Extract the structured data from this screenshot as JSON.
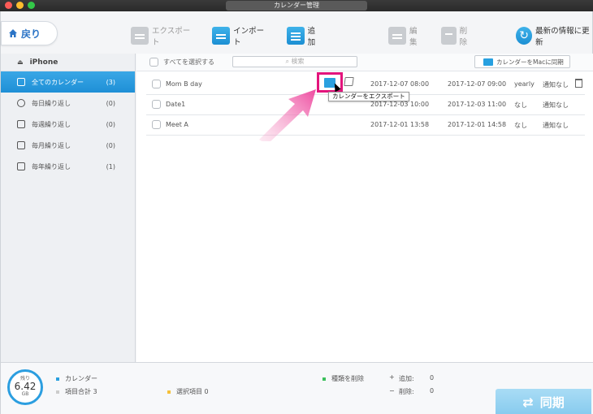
{
  "window": {
    "title": "カレンダー管理"
  },
  "nav": {
    "back_label": "戻り"
  },
  "toolbar": {
    "export_label": "エクスポート",
    "import_label": "インポート",
    "add_label": "追加",
    "edit_label": "編集",
    "delete_label": "削除",
    "refresh_label": "最新の情報に更新"
  },
  "sidebar": {
    "device": "iPhone",
    "items": [
      {
        "label": "全てのカレンダー",
        "count": "(3)"
      },
      {
        "label": "毎日繰り返し",
        "count": "(0)"
      },
      {
        "label": "毎週繰り返し",
        "count": "(0)"
      },
      {
        "label": "毎月繰り返し",
        "count": "(0)"
      },
      {
        "label": "毎年繰り返し",
        "count": "(1)"
      }
    ]
  },
  "list": {
    "select_all_label": "すべてを選択する",
    "search_placeholder": "検索",
    "sync_mac_label": "カレンダーをMacに同期",
    "rows": [
      {
        "name": "Mom  B day",
        "start": "2017-12-07 08:00",
        "end": "2017-12-07 09:00",
        "repeat": "yearly",
        "alert": "通知なし"
      },
      {
        "name": "Date1",
        "start": "2017-12-03 10:00",
        "end": "2017-12-03 11:00",
        "repeat": "なし",
        "alert": "通知なし"
      },
      {
        "name": "Meet A",
        "start": "2017-12-01 13:58",
        "end": "2017-12-01 14:58",
        "repeat": "なし",
        "alert": "通知なし"
      }
    ],
    "tooltip": "カレンダーをエクスポート"
  },
  "footer": {
    "remaining_label": "残り",
    "remaining_value": "6.42",
    "remaining_unit": "GB",
    "category_label": "カレンダー",
    "total_items": "項目合計 3",
    "selected_items": "選択項目 0",
    "delete_type_label": "種類を削除",
    "add_label": "追加:",
    "add_value": "0",
    "delete_label": "削除:",
    "delete_value": "0",
    "sync_label": "同期"
  },
  "colors": {
    "accent": "#1e8fd6",
    "highlight": "#e3147c",
    "legend_calendar": "#2aa0df",
    "legend_selected": "#f5c03a",
    "legend_delete": "#3bbf5c"
  }
}
